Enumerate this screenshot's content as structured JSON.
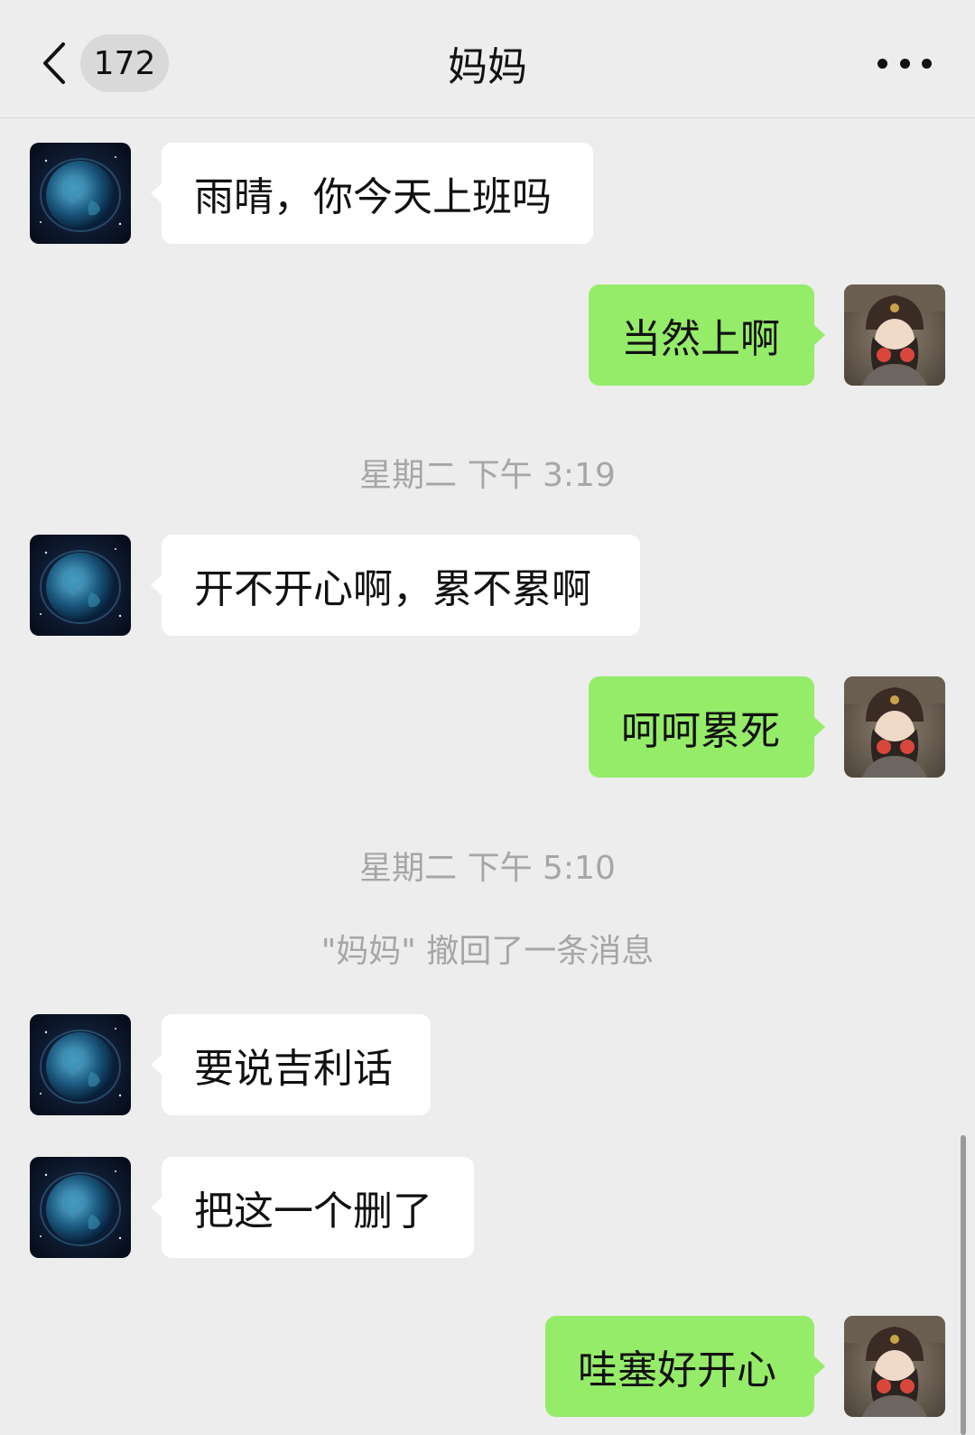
{
  "header": {
    "unread_count": "172",
    "title": "妈妈"
  },
  "messages": [
    {
      "side": "in",
      "text": "雨晴，你今天上班吗"
    },
    {
      "side": "out",
      "text": "当然上啊"
    },
    {
      "timestamp": "星期二 下午 3:19"
    },
    {
      "side": "in",
      "text": "开不开心啊，累不累啊"
    },
    {
      "side": "out",
      "text": "呵呵累死"
    },
    {
      "timestamp": "星期二 下午 5:10"
    },
    {
      "system": "\"妈妈\" 撤回了一条消息"
    },
    {
      "side": "in",
      "text": "要说吉利话"
    },
    {
      "side": "in",
      "text": "把这一个删了"
    },
    {
      "side": "out",
      "text": "哇塞好开心"
    }
  ],
  "colors": {
    "background": "#ededed",
    "incoming_bubble": "#ffffff",
    "outgoing_bubble": "#95ec69",
    "system_text": "#a6a6a6"
  },
  "icons": {
    "back": "chevron-left-icon",
    "more": "more-dots-icon",
    "contact_avatar": "earth-planet-avatar",
    "self_avatar": "user-photo-avatar"
  }
}
